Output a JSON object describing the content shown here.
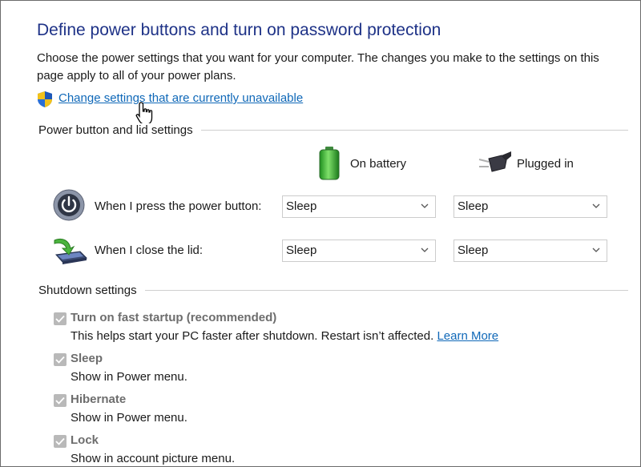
{
  "page": {
    "title": "Define power buttons and turn on password protection",
    "description": "Choose the power settings that you want for your computer. The changes you make to the settings on this page apply to all of your power plans.",
    "change_link": "Change settings that are currently unavailable"
  },
  "power_lid": {
    "section_title": "Power button and lid settings",
    "col_battery": "On battery",
    "col_plugged": "Plugged in",
    "rows": [
      {
        "label": "When I press the power button:",
        "battery": "Sleep",
        "plugged": "Sleep"
      },
      {
        "label": "When I close the lid:",
        "battery": "Sleep",
        "plugged": "Sleep"
      }
    ]
  },
  "shutdown": {
    "section_title": "Shutdown settings",
    "options": [
      {
        "label": "Turn on fast startup (recommended)",
        "desc": "This helps start your PC faster after shutdown. Restart isn’t affected.",
        "link": "Learn More",
        "checked": true
      },
      {
        "label": "Sleep",
        "desc": "Show in Power menu.",
        "checked": true
      },
      {
        "label": "Hibernate",
        "desc": "Show in Power menu.",
        "checked": true
      },
      {
        "label": "Lock",
        "desc": "Show in account picture menu.",
        "checked": true
      }
    ]
  },
  "icons": {
    "shield": "uac-shield-icon",
    "cursor": "hand-pointer-icon",
    "battery": "battery-icon",
    "plug": "power-plug-icon",
    "power": "power-button-icon",
    "lid": "laptop-lid-icon",
    "chevron": "chevron-down-icon",
    "check": "checkmark-icon"
  },
  "colors": {
    "title": "#1e3287",
    "link": "#0f68b8",
    "disabled_text": "#6d6d6d",
    "checkbox_disabled": "#b9b9b9"
  }
}
